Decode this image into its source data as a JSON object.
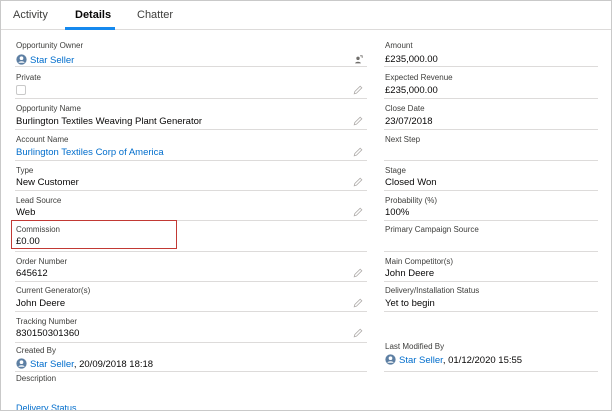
{
  "tabs": [
    {
      "label": "Activity"
    },
    {
      "label": "Details"
    },
    {
      "label": "Chatter"
    }
  ],
  "left_fields": [
    {
      "label": "Opportunity Owner",
      "value": "Star Seller"
    },
    {
      "label": "Private",
      "value": ""
    },
    {
      "label": "Opportunity Name",
      "value": "Burlington Textiles Weaving Plant Generator"
    },
    {
      "label": "Account Name",
      "value": "Burlington Textiles Corp of America"
    },
    {
      "label": "Type",
      "value": "New Customer"
    },
    {
      "label": "Lead Source",
      "value": "Web"
    },
    {
      "label": "Commission",
      "value": "£0.00"
    },
    {
      "label": "Order Number",
      "value": "645612"
    },
    {
      "label": "Current Generator(s)",
      "value": "John Deere"
    },
    {
      "label": "Tracking Number",
      "value": "830150301360"
    },
    {
      "label": "Created By",
      "value": "Star Seller",
      "suffix": ", 20/09/2018 18:18"
    },
    {
      "label": "Description",
      "value": ""
    }
  ],
  "right_fields": [
    {
      "label": "Amount",
      "value": "£235,000.00"
    },
    {
      "label": "Expected Revenue",
      "value": "£235,000.00"
    },
    {
      "label": "Close Date",
      "value": "23/07/2018"
    },
    {
      "label": "Next Step",
      "value": ""
    },
    {
      "label": "Stage",
      "value": "Closed Won"
    },
    {
      "label": "Probability (%)",
      "value": "100%"
    },
    {
      "label": "Primary Campaign Source",
      "value": ""
    },
    {
      "label": "Main Competitor(s)",
      "value": "John Deere"
    },
    {
      "label": "Delivery/Installation Status",
      "value": "Yet to begin"
    },
    {
      "label": "Last Modified By",
      "value": "Star Seller",
      "suffix": ", 01/12/2020 15:55"
    }
  ],
  "clipped_label": "Delivery Status",
  "icons": {
    "avatar": "user-avatar-icon",
    "edit": "pencil-icon",
    "change_owner": "change-owner-icon"
  },
  "colors": {
    "link": "#006dcc",
    "tab_active_underline": "#1589ee",
    "highlight_box": "#c23934"
  }
}
